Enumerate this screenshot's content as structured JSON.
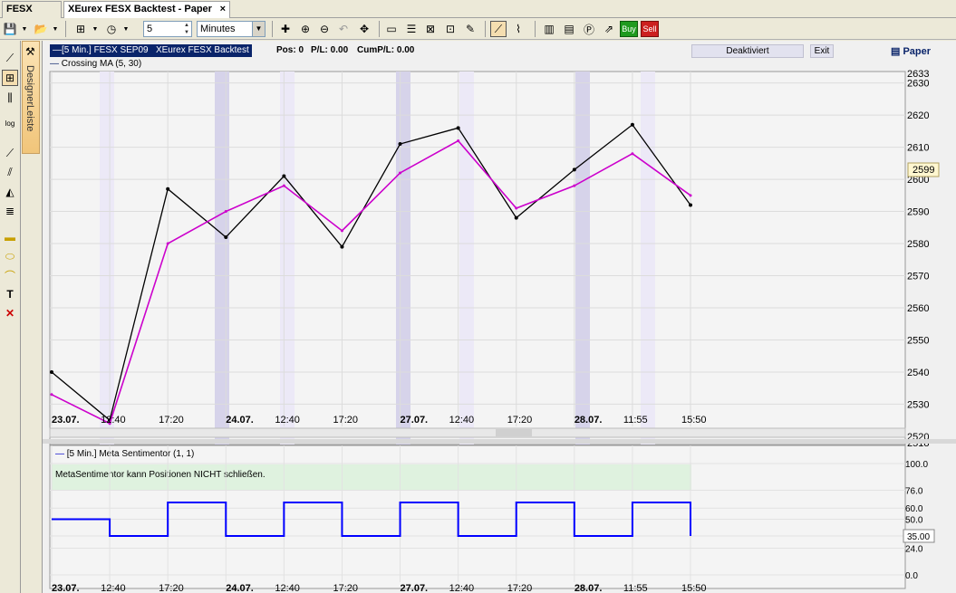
{
  "tabs": [
    {
      "label": "FESX SEP09"
    },
    {
      "label": "XEurex  FESX Backtest - Paper",
      "close": "×"
    }
  ],
  "toolbar": {
    "interval_value": "5",
    "unit_value": "Minutes",
    "buy_label": "Buy",
    "sell_label": "Sell"
  },
  "designer": {
    "label": "DesignerLeiste"
  },
  "header": {
    "instrument": "[5 Min.] FESX SEP09",
    "account": "XEurex FESX Backtest",
    "pos": "Pos: 0",
    "pl": "P/L: 0.00",
    "cumpl": "CumP/L: 0.00",
    "deaktiviert": "Deaktiviert",
    "exit": "Exit",
    "paper": "Paper",
    "indicator": "Crossing MA  (5, 30)"
  },
  "price_chart": {
    "y_ticks": [
      "2633",
      "2630",
      "2620",
      "2610",
      "2600",
      "2590",
      "2580",
      "2570",
      "2560",
      "2550",
      "2540",
      "2530",
      "2520",
      "2518"
    ],
    "last_price": "2599",
    "x_labels": [
      "23.07.",
      "12:40",
      "17:20",
      "24.07.",
      "12:40",
      "17:20",
      "27.07.",
      "12:40",
      "17:20",
      "28.07.",
      "11:55",
      "15:50"
    ]
  },
  "sentiment_panel": {
    "title": "[5 Min.] Meta Sentimentor  (1, 1)",
    "note": "MetaSentimentor kann Positionen NICHT schließen.",
    "y_ticks": [
      "100.0",
      "76.0",
      "60.0",
      "50.0",
      "35.0",
      "24.0",
      "0.0"
    ],
    "last_value": "35.00",
    "x_labels": [
      "23.07.",
      "12:40",
      "17:20",
      "24.07.",
      "12:40",
      "17:20",
      "27.07.",
      "12:40",
      "17:20",
      "28.07.",
      "11:55",
      "15:50"
    ]
  },
  "chart_data": {
    "type": "line",
    "title": "",
    "xlabel": "",
    "ylabel": "",
    "ylim": [
      2518,
      2633
    ],
    "x": [
      "23.07.",
      "12:40",
      "17:20",
      "24.07.",
      "12:40",
      "17:20",
      "27.07.",
      "12:40",
      "17:20",
      "28.07.",
      "11:55",
      "15:50"
    ],
    "series": [
      {
        "name": "[5 Min.] FESX SEP09",
        "values": [
          2540,
          2525,
          2597,
          2582,
          2601,
          2579,
          2611,
          2616,
          2588,
          2603,
          2617,
          2592
        ]
      },
      {
        "name": "Crossing MA  (5, 30)",
        "values": [
          2533,
          2524,
          2580,
          2590,
          2598,
          2584,
          2602,
          2612,
          2591,
          2598,
          2608,
          2595
        ]
      }
    ],
    "sentiment_series": {
      "name": "[5 Min.] Meta Sentimentor  (1, 1)",
      "ylim": [
        0,
        100
      ],
      "values": [
        50,
        35,
        65,
        35,
        65,
        35,
        65,
        35,
        65,
        35,
        65,
        35
      ]
    },
    "colors": {
      "price": "#000000",
      "ma": "#cc00cc",
      "sentiment": "#0000ff",
      "session_dark": "#d6d3ea",
      "session_light": "#ece9f7"
    }
  }
}
